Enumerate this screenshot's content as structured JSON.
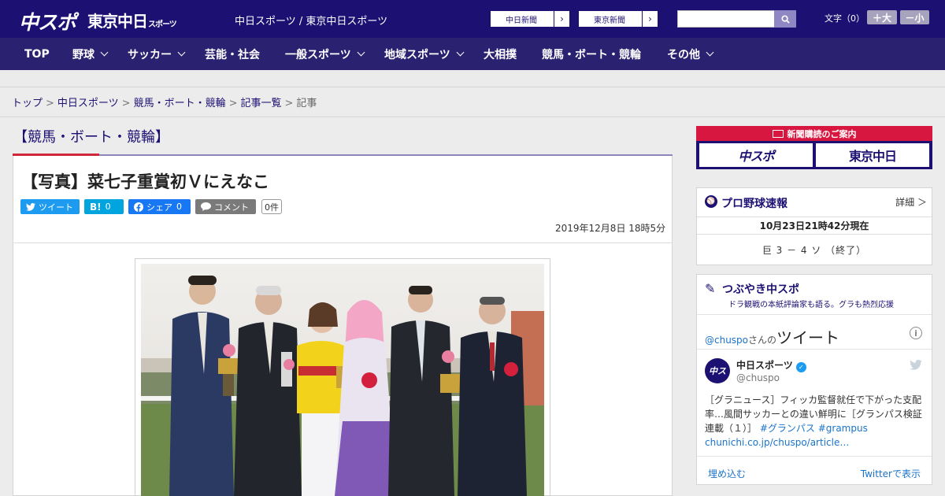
{
  "header": {
    "logo_chuspo": "中スポ",
    "logo_tokyo": "東京中日",
    "logo_tokyo_small": "スポーツ",
    "site_name": "中日スポーツ / 東京中日スポーツ",
    "partner_links": [
      "中日新聞",
      "東京新聞"
    ],
    "fontsize_label": "文字（0）",
    "fontsize_up": "＋大",
    "fontsize_down": "－小"
  },
  "nav": {
    "items": [
      {
        "label": "TOP",
        "dropdown": false
      },
      {
        "label": "野球",
        "dropdown": true
      },
      {
        "label": "サッカー",
        "dropdown": true
      },
      {
        "label": "芸能・社会",
        "dropdown": false
      },
      {
        "label": "一般スポーツ",
        "dropdown": true
      },
      {
        "label": "地域スポーツ",
        "dropdown": true
      },
      {
        "label": "大相撲",
        "dropdown": false
      },
      {
        "label": "競馬・ボート・競輪",
        "dropdown": false
      },
      {
        "label": "その他",
        "dropdown": true
      }
    ]
  },
  "breadcrumb": {
    "items": [
      "トップ",
      "中日スポーツ",
      "競馬・ボート・競輪",
      "記事一覧",
      "記事"
    ]
  },
  "article": {
    "category": "【競馬・ボート・競輪】",
    "title": "【写真】菜七子重賞初Ｖにえなこ",
    "share": {
      "tweet": "ツイート",
      "hatena_icon": "B!",
      "hatena_count": "0",
      "facebook": "シェア",
      "facebook_count": "0",
      "comment": "コメント",
      "comment_count": "0件"
    },
    "date": "2019年12月8日 18時5分"
  },
  "sidebar": {
    "subscription": {
      "title": "新聞購読のご案内",
      "logo_chuspo": "中スポ",
      "logo_tokyo": "東京中日"
    },
    "baseball": {
      "title": "プロ野球速報",
      "detail": "詳細 ＞",
      "time": "10月23日21時42分現在",
      "score": "巨 3 － 4 ソ （終了）"
    },
    "twitter": {
      "title": "つぶやき中スポ",
      "subtitle": "ドラ観戦の本紙評論家も語る。グラも熱烈応援",
      "handle": "@chuspo",
      "handle_suffix": "さんの",
      "heading": "ツイート",
      "tweet": {
        "name": "中日スポーツ",
        "at": "@chuspo",
        "text": "［グラニュース］フィッカ監督就任で下がった支配率…風間サッカーとの違い鮮明に［グランパス検証連載（１）］",
        "tags": "#グランパス #grampus",
        "link": "chunichi.co.jp/chuspo/article…"
      },
      "embed": "埋め込む",
      "view": "Twitterで表示"
    }
  }
}
